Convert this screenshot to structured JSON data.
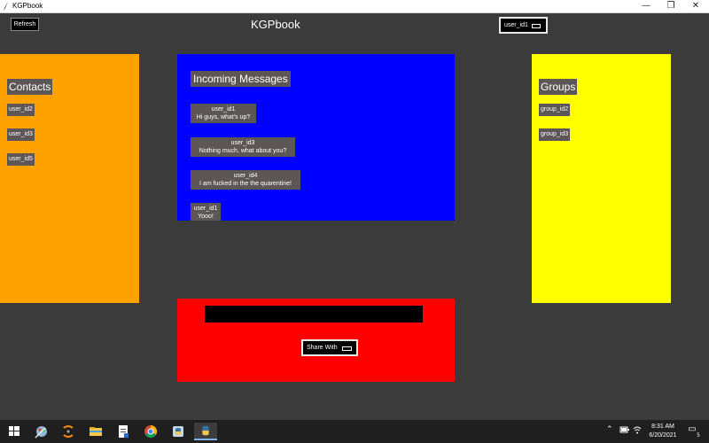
{
  "window": {
    "title": "KGPbook",
    "controls": {
      "minimize": "—",
      "maximize": "❐",
      "close": "✕"
    }
  },
  "header": {
    "refresh_label": "Refresh",
    "app_title": "KGPbook",
    "current_user": "user_id1"
  },
  "contacts": {
    "heading": "Contacts",
    "items": [
      "user_id2",
      "user_id3",
      "user_id5"
    ]
  },
  "messages": {
    "heading": "Incoming Messages",
    "items": [
      {
        "sender": "user_id1",
        "text": "Hi guys, what's up?"
      },
      {
        "sender": "user_id3",
        "text": "Nothing much, what about you?"
      },
      {
        "sender": "user_id4",
        "text": "I am fucked in the the quarentine!"
      },
      {
        "sender": "user_id1",
        "text": "Yooo!"
      }
    ]
  },
  "groups": {
    "heading": "Groups",
    "items": [
      "group_id2",
      "group_id3"
    ]
  },
  "compose": {
    "input_value": "",
    "share_label": "Share With"
  },
  "colors": {
    "contacts_bg": "#ffa200",
    "messages_bg": "#0000ff",
    "groups_bg": "#ffff00",
    "compose_bg": "#ff0000",
    "app_bg": "#3b3b3b"
  },
  "taskbar": {
    "icons": [
      "windows-start-icon",
      "paint-icon",
      "swirl-app-icon",
      "file-explorer-icon",
      "document-app-icon",
      "chrome-icon",
      "python-idle-icon",
      "python-app-icon"
    ],
    "tray_icons": [
      "chevron-up-icon",
      "battery-icon",
      "wifi-icon"
    ],
    "time": "8:31 AM",
    "date": "6/20/2021",
    "notification_count": "5"
  }
}
